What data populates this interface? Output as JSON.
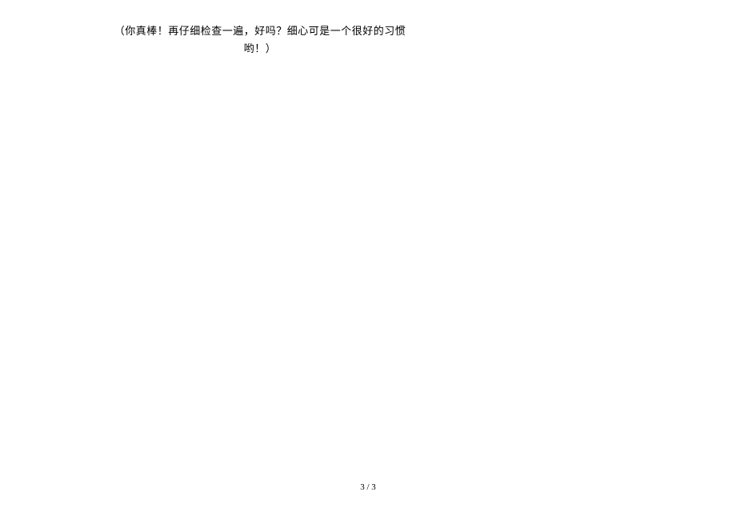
{
  "body": {
    "line1": "（你真棒！再仔细检查一遍，好吗？细心可是一个很好的习惯",
    "line2": "哟！）"
  },
  "footer": {
    "page_number": "3 / 3"
  }
}
